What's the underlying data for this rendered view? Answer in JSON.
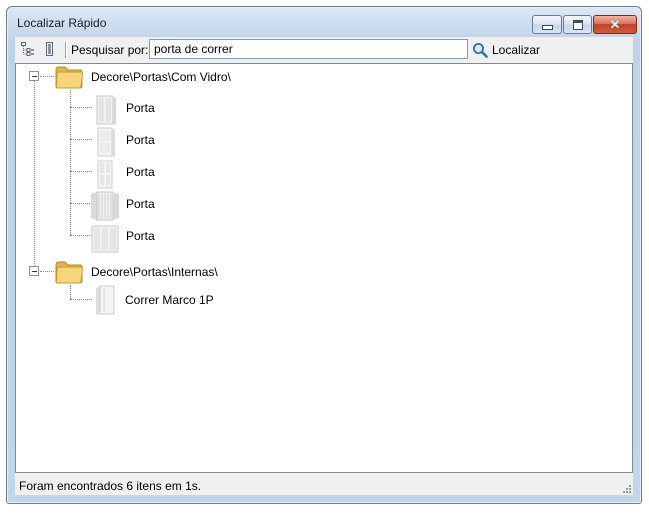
{
  "window": {
    "title": "Localizar Rápido",
    "minimize_icon": "minimize-icon",
    "maximize_icon": "maximize-icon",
    "close_icon": "close-icon",
    "close_glyph": "✕"
  },
  "toolbar": {
    "expand_icon": "tree-expand-icon",
    "collapse_icon": "tree-collapse-icon",
    "search_label": "Pesquisar por:",
    "search_value": "porta de correr",
    "find_icon": "magnifier-icon",
    "find_label": "Localizar"
  },
  "tree": {
    "groups": [
      {
        "path": "Decore\\Portas\\Com Vidro\\",
        "icon": "folder-icon",
        "items": [
          {
            "label": "Porta",
            "icon": "door-icon"
          },
          {
            "label": "Porta",
            "icon": "door-icon"
          },
          {
            "label": "Porta",
            "icon": "door-icon"
          },
          {
            "label": "Porta",
            "icon": "door-icon"
          },
          {
            "label": "Porta",
            "icon": "door-icon"
          }
        ]
      },
      {
        "path": "Decore\\Portas\\Internas\\",
        "icon": "folder-icon",
        "items": [
          {
            "label": "Correr Marco 1P",
            "icon": "door-icon"
          }
        ]
      }
    ]
  },
  "status": {
    "text": "Foram encontrados 6 itens em 1s."
  },
  "colors": {
    "title_bar": "#c9d9ec",
    "close_button": "#c0412a",
    "search_border": "#7a9cc4"
  }
}
